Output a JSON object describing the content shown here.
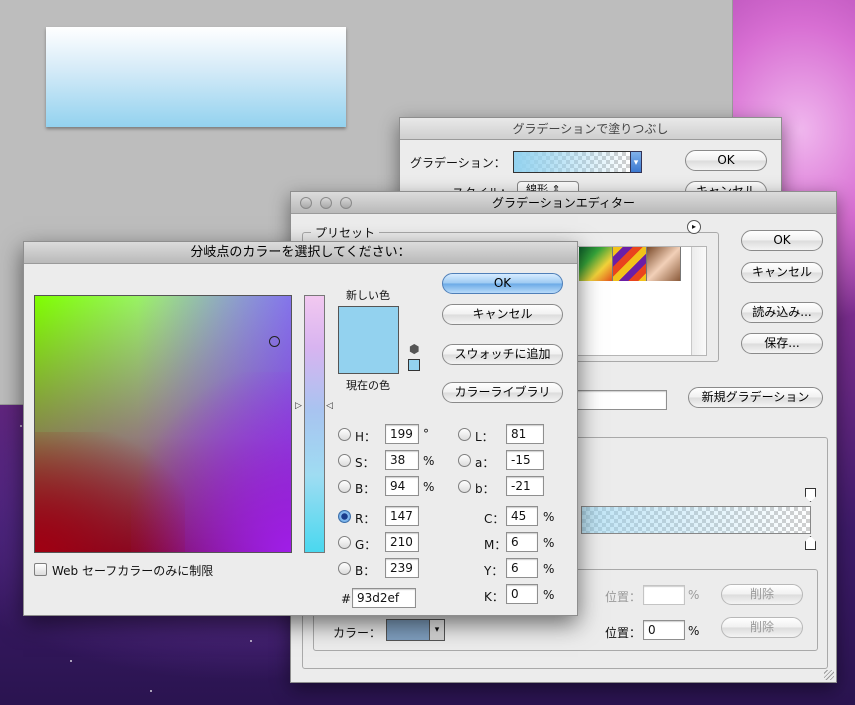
{
  "fill_dialog": {
    "title": "グラデーションで塗りつぶし",
    "gradient_label": "グラデーション：",
    "style_label": "スタイル：",
    "style_value": "線形",
    "ok": "OK",
    "cancel": "キャンセル"
  },
  "editor": {
    "title": "グラデーションエディター",
    "preset_label": "プリセット",
    "preset_swatch_colors": [
      "#1d7a2a",
      "#e2541a",
      "#4a2cb0",
      "#e6c42a",
      "#b08a6a"
    ],
    "ok": "OK",
    "cancel": "キャンセル",
    "load": "読み込み...",
    "save": "保存...",
    "new_gradient": "新規グラデーション",
    "stop_opacity_position_label": "位置：",
    "stop_opacity_position_value": "",
    "stop_opacity_delete": "削除",
    "color_label": "カラー：",
    "color_swatch": "#7f9fbf",
    "stop_color_position_label": "位置：",
    "stop_color_position_value": "0",
    "stop_color_delete": "削除",
    "percent": "%"
  },
  "picker": {
    "title": "分岐点のカラーを選択してください：",
    "new_color_label": "新しい色",
    "current_color_label": "現在の色",
    "new_color": "#93d2ef",
    "current_color": "#93d2ef",
    "ok": "OK",
    "cancel": "キャンセル",
    "add_to_swatches": "スウォッチに追加",
    "color_libraries": "カラーライブラリ",
    "web_safe_label": "Web セーフカラーのみに制限",
    "hsb": [
      {
        "label": "H：",
        "value": "199",
        "unit": "°"
      },
      {
        "label": "S：",
        "value": "38",
        "unit": "%"
      },
      {
        "label": "B：",
        "value": "94",
        "unit": "%"
      }
    ],
    "rgb": [
      {
        "label": "R：",
        "value": "147"
      },
      {
        "label": "G：",
        "value": "210"
      },
      {
        "label": "B：",
        "value": "239"
      }
    ],
    "lab": [
      {
        "label": "L：",
        "value": "81"
      },
      {
        "label": "a：",
        "value": "-15"
      },
      {
        "label": "b：",
        "value": "-21"
      }
    ],
    "cmyk": [
      {
        "label": "C：",
        "value": "45",
        "unit": "%"
      },
      {
        "label": "M：",
        "value": "6",
        "unit": "%"
      },
      {
        "label": "Y：",
        "value": "6",
        "unit": "%"
      },
      {
        "label": "K：",
        "value": "0",
        "unit": "%"
      }
    ],
    "hex_label": "#",
    "hex_value": "93d2ef",
    "selected_channel": "R"
  }
}
